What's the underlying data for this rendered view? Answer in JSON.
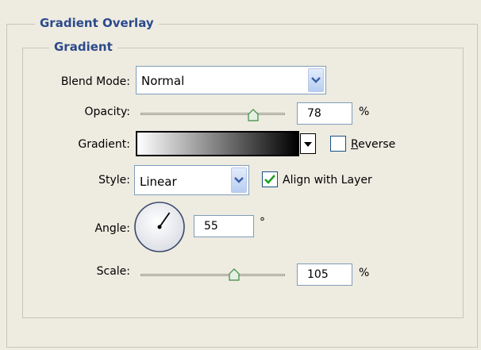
{
  "panel": {
    "title": "Gradient Overlay",
    "section_title": "Gradient"
  },
  "blend_mode": {
    "label": "Blend Mode:",
    "value": "Normal"
  },
  "opacity": {
    "label": "Opacity:",
    "value": "78",
    "unit": "%",
    "slider_fraction": 0.78
  },
  "gradient": {
    "label": "Gradient:",
    "reverse_label": "Reverse",
    "reverse_checked": false,
    "colors": [
      "#ffffff",
      "#000000"
    ]
  },
  "style": {
    "label": "Style:",
    "value": "Linear",
    "align_label": "Align with Layer",
    "align_checked": true
  },
  "angle": {
    "label": "Angle:",
    "value": "55",
    "unit": "°"
  },
  "scale": {
    "label": "Scale:",
    "value": "105",
    "unit": "%",
    "slider_fraction": 0.7
  },
  "colors": {
    "accent": "#2b4a8c",
    "check": "#21a121",
    "combo_border": "#7f9db9"
  }
}
